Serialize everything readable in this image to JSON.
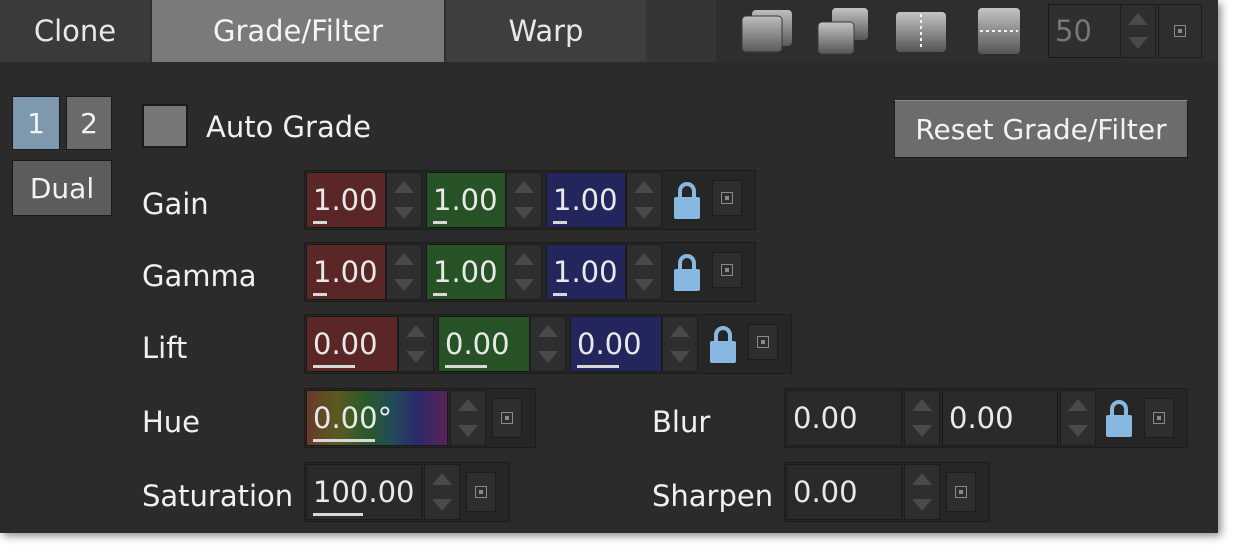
{
  "tabs": {
    "clone": "Clone",
    "grade_filter": "Grade/Filter",
    "warp": "Warp"
  },
  "toolbar": {
    "value": "50",
    "icons": [
      "overlap-stack-icon",
      "offset-stack-icon",
      "split-vertical-icon",
      "split-horizontal-icon"
    ]
  },
  "view": {
    "btn1": "1",
    "btn2": "2",
    "dual": "Dual"
  },
  "auto_grade": {
    "label": "Auto Grade",
    "checked": false
  },
  "reset_button": "Reset Grade/Filter",
  "gain": {
    "label": "Gain",
    "r": "1.00",
    "g": "1.00",
    "b": "1.00"
  },
  "gamma": {
    "label": "Gamma",
    "r": "1.00",
    "g": "1.00",
    "b": "1.00"
  },
  "lift": {
    "label": "Lift",
    "r": "0.00",
    "g": "0.00",
    "b": "0.00"
  },
  "hue": {
    "label": "Hue",
    "value": "0.00°"
  },
  "saturation": {
    "label": "Saturation",
    "value": "100.00"
  },
  "blur": {
    "label": "Blur",
    "x": "0.00",
    "y": "0.00"
  },
  "sharpen": {
    "label": "Sharpen",
    "value": "0.00"
  },
  "colors": {
    "red_field": "#5a2626",
    "green_field": "#265226",
    "blue_field": "#22265c",
    "lock": "#88b7e0",
    "active_tab": "#7a7a7a",
    "view_active": "#7e98ad"
  }
}
